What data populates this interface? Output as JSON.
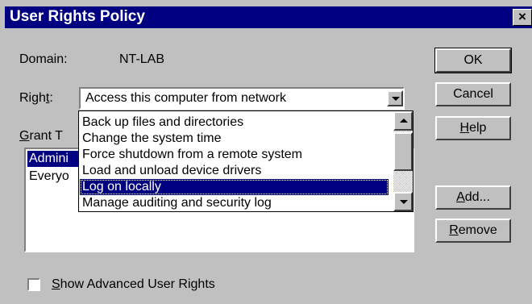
{
  "window": {
    "title": "User Rights Policy",
    "close_glyph": "×"
  },
  "domain": {
    "label": "Domain:",
    "value": "NT-LAB"
  },
  "right": {
    "label_pre": "Righ",
    "label_u": "t",
    "label_post": ":",
    "selected": "Access this computer from network"
  },
  "grant": {
    "label_u": "G",
    "label_post": "rant T"
  },
  "grant_list": [
    {
      "name": "Admini",
      "selected": true
    },
    {
      "name": "Everyo",
      "selected": false
    }
  ],
  "dropdown_items": [
    {
      "label": "Back up files and directories",
      "selected": false
    },
    {
      "label": "Change the system time",
      "selected": false
    },
    {
      "label": "Force shutdown from a remote system",
      "selected": false
    },
    {
      "label": "Load and unload device drivers",
      "selected": false
    },
    {
      "label": "Log on locally",
      "selected": true
    },
    {
      "label": "Manage auditing and security log",
      "selected": false
    }
  ],
  "buttons": {
    "ok": "OK",
    "cancel": "Cancel",
    "help_u": "H",
    "help_rest": "elp",
    "add_u": "A",
    "add_rest": "dd...",
    "remove_u": "R",
    "remove_rest": "emove"
  },
  "advanced": {
    "label_u": "S",
    "label_rest": "how Advanced User Rights",
    "checked": false
  },
  "colors": {
    "title_bar": "#000080",
    "face": "#c0c0c0",
    "highlight": "#000080"
  }
}
